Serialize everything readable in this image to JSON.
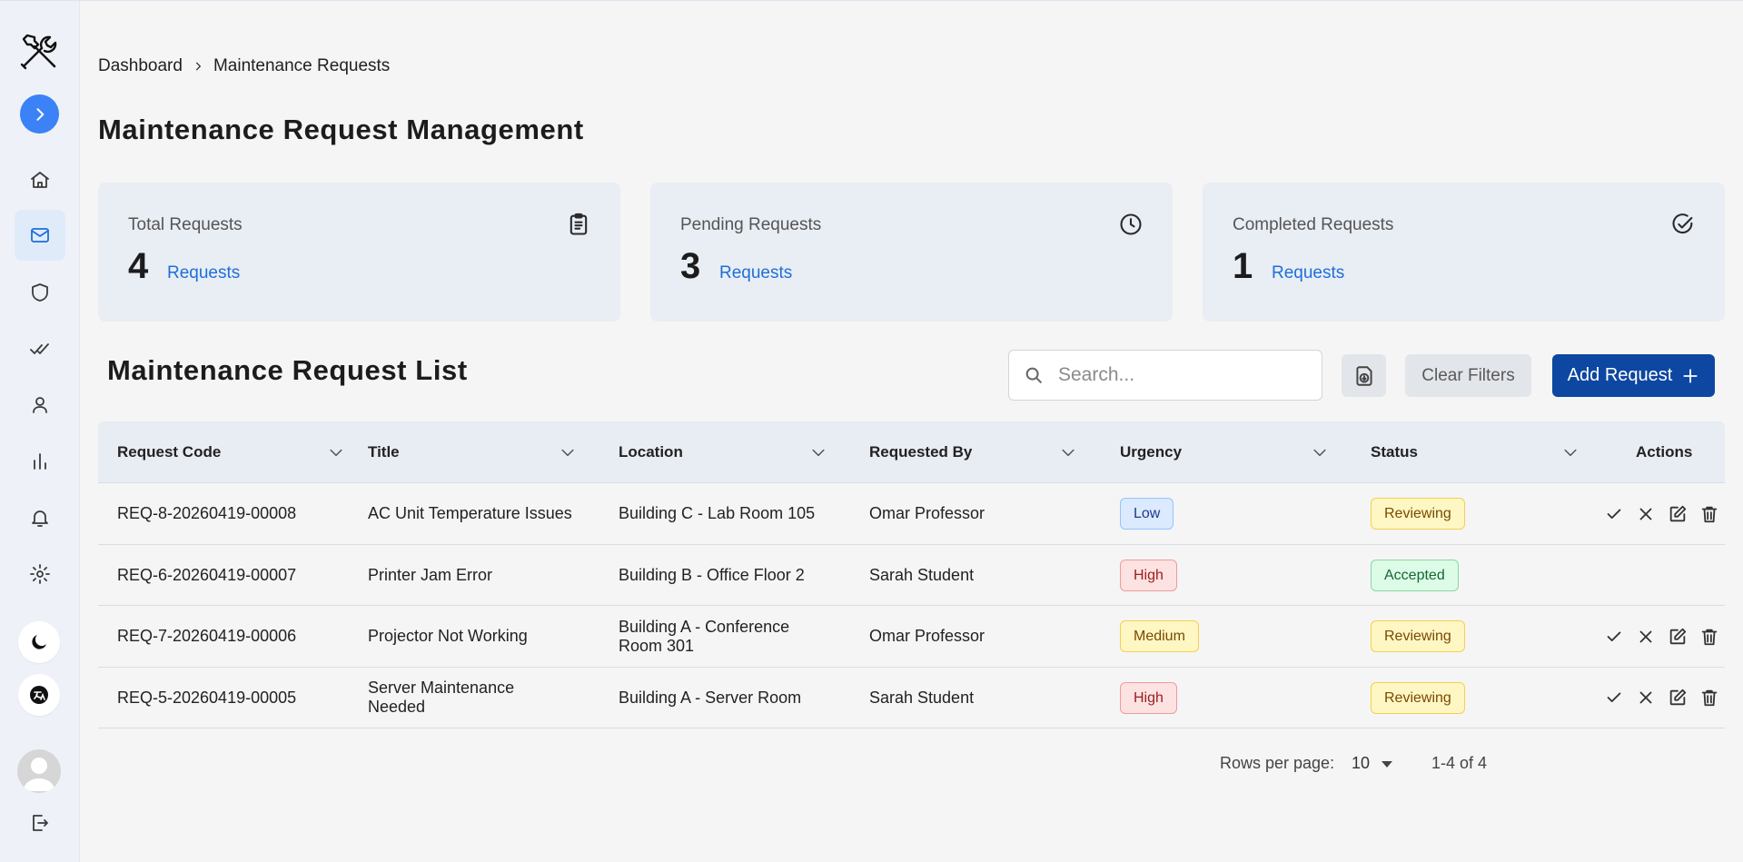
{
  "breadcrumb": {
    "home": "Dashboard",
    "current": "Maintenance Requests"
  },
  "page_title": "Maintenance Request Management",
  "cards": [
    {
      "label": "Total Requests",
      "count": "4",
      "unit": "Requests",
      "icon": "clipboard-list-icon"
    },
    {
      "label": "Pending Requests",
      "count": "3",
      "unit": "Requests",
      "icon": "clock-icon"
    },
    {
      "label": "Completed Requests",
      "count": "1",
      "unit": "Requests",
      "icon": "check-circle-icon"
    }
  ],
  "list": {
    "title": "Maintenance Request List",
    "search_placeholder": "Search...",
    "clear_filters": "Clear Filters",
    "add_request": "Add Request"
  },
  "table": {
    "headers": {
      "code": "Request Code",
      "title": "Title",
      "location": "Location",
      "requested_by": "Requested By",
      "urgency": "Urgency",
      "status": "Status",
      "actions": "Actions"
    },
    "rows": [
      {
        "code": "REQ-8-20260419-00008",
        "title": "AC Unit Temperature Issues",
        "location": "Building C - Lab Room 105",
        "requested_by": "Omar Professor",
        "urgency": "Low",
        "status": "Reviewing"
      },
      {
        "code": "REQ-6-20260419-00007",
        "title": "Printer Jam Error",
        "location": "Building B - Office Floor 2",
        "requested_by": "Sarah Student",
        "urgency": "High",
        "status": "Accepted"
      },
      {
        "code": "REQ-7-20260419-00006",
        "title": "Projector Not Working",
        "location": "Building A - Conference Room 301",
        "requested_by": "Omar Professor",
        "urgency": "Medium",
        "status": "Reviewing"
      },
      {
        "code": "REQ-5-20260419-00005",
        "title": "Server Maintenance Needed",
        "location": "Building A - Server Room",
        "requested_by": "Sarah Student",
        "urgency": "High",
        "status": "Reviewing"
      }
    ]
  },
  "pagination": {
    "rows_per_page_label": "Rows per page:",
    "rows_per_page": "10",
    "range": "1-4 of 4"
  },
  "colors": {
    "primary": "#0d47a1",
    "accent": "#1e6fd9",
    "toggle": "#3b82f6"
  }
}
